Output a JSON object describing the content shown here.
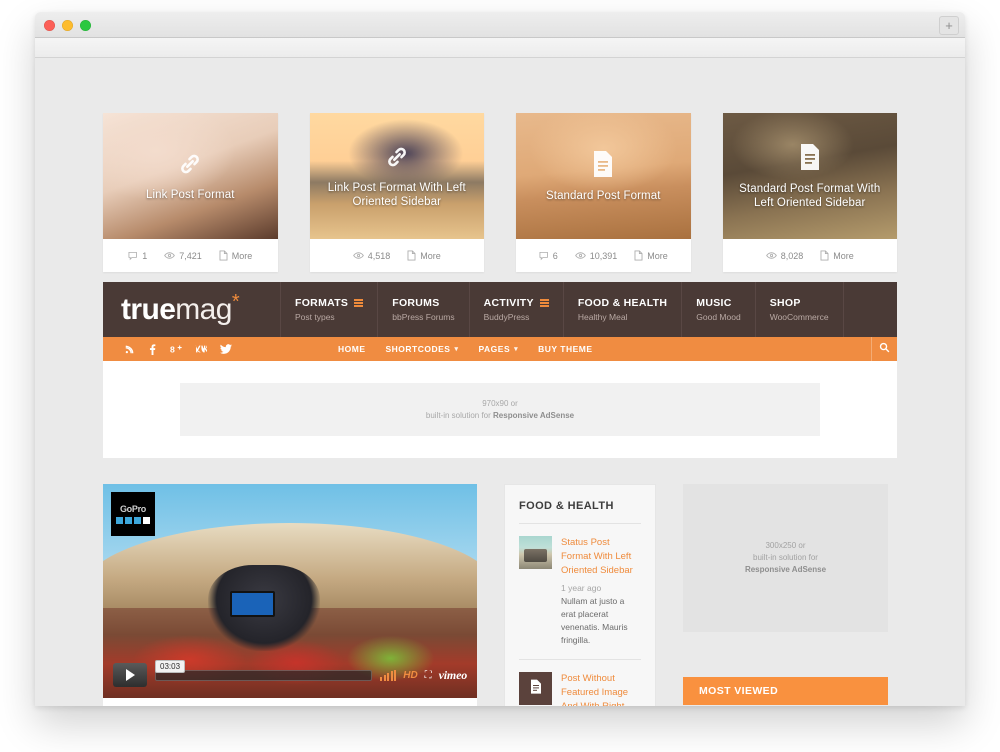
{
  "browser": {
    "new_tab_label": "+",
    "window_controls": [
      "close",
      "minimize",
      "maximize"
    ]
  },
  "featured_cards": [
    {
      "title": "Link Post Format",
      "format_icon": "link-icon",
      "comments": "1",
      "views": "7,421",
      "more_label": "More",
      "has_comments": true
    },
    {
      "title": "Link Post Format With Left Oriented Sidebar",
      "format_icon": "link-icon",
      "comments": "",
      "views": "4,518",
      "more_label": "More",
      "has_comments": false
    },
    {
      "title": "Standard Post Format",
      "format_icon": "document-icon",
      "comments": "6",
      "views": "10,391",
      "more_label": "More",
      "has_comments": true
    },
    {
      "title": "Standard Post Format With Left Oriented Sidebar",
      "format_icon": "document-icon",
      "comments": "",
      "views": "8,028",
      "more_label": "More",
      "has_comments": false
    }
  ],
  "header": {
    "logo": {
      "bold": "true",
      "light": "mag",
      "star": "*"
    },
    "nav": [
      {
        "label": "FORMATS",
        "sub": "Post types",
        "has_burger": true
      },
      {
        "label": "FORUMS",
        "sub": "bbPress Forums",
        "has_burger": false
      },
      {
        "label": "ACTIVITY",
        "sub": "BuddyPress",
        "has_burger": true
      },
      {
        "label": "FOOD & HEALTH",
        "sub": "Healthy Meal",
        "has_burger": false
      },
      {
        "label": "MUSIC",
        "sub": "Good Mood",
        "has_burger": false
      },
      {
        "label": "SHOP",
        "sub": "WooCommerce",
        "has_burger": false
      }
    ]
  },
  "subnav": {
    "social": [
      "rss-icon",
      "facebook-icon",
      "googleplus-icon",
      "vk-icon",
      "twitter-icon"
    ],
    "menu": [
      {
        "label": "HOME",
        "caret": false
      },
      {
        "label": "SHORTCODES",
        "caret": true
      },
      {
        "label": "PAGES",
        "caret": true
      },
      {
        "label": "BUY THEME",
        "caret": false
      }
    ],
    "search_icon": "search-icon"
  },
  "ads": {
    "leaderboard": {
      "size": "970x90 or",
      "line2_prefix": "built-in solution for ",
      "line2_bold": "Responsive AdSense"
    },
    "rectangle": {
      "size": "300x250 or",
      "line2": "built-in solution for",
      "line3_bold": "Responsive AdSense"
    }
  },
  "video": {
    "brand": "GoPro",
    "current_time": "03:03",
    "quality_label": "HD",
    "provider": "vimeo"
  },
  "widget": {
    "title": "FOOD & HEALTH",
    "posts": [
      {
        "title": "Status Post Format With Left Oriented Sidebar",
        "date": "1 year ago",
        "excerpt": "Nullam at justo a erat placerat venenatis. Mauris fringilla.",
        "thumb": "photo"
      },
      {
        "title": "Post Without Featured Image And With Right",
        "date": "",
        "excerpt": "",
        "thumb": "document-icon"
      }
    ]
  },
  "most_viewed": {
    "title": "MOST VIEWED"
  },
  "colors": {
    "brand_orange": "#f08c41",
    "header_brown": "#4a3a36",
    "page_bg": "#eaeaea",
    "link_orange": "#ef8b3c"
  }
}
